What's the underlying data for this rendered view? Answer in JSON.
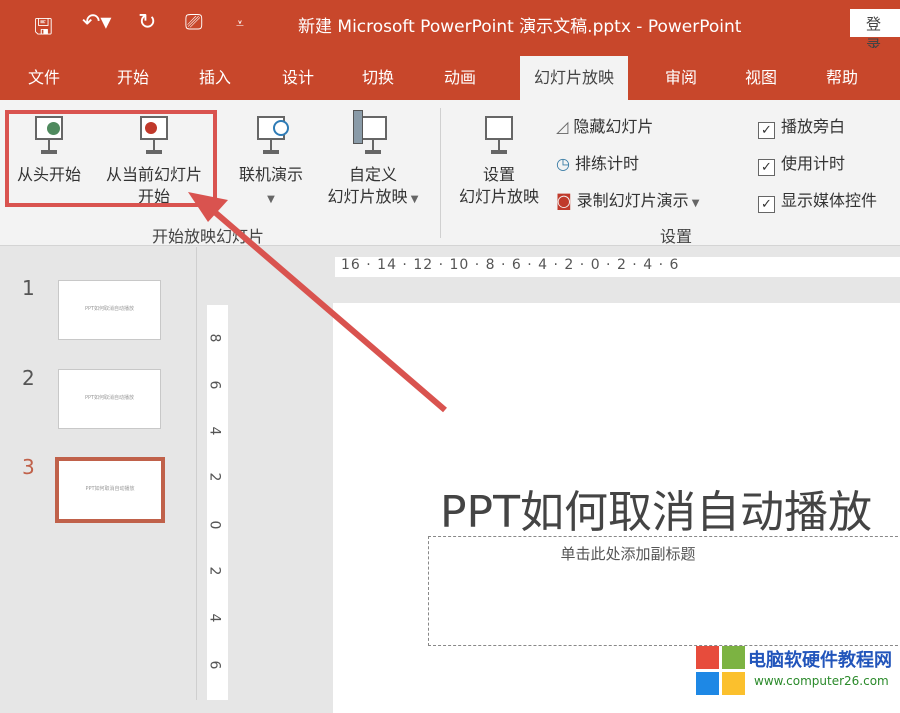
{
  "titlebar": {
    "title": "新建 Microsoft PowerPoint 演示文稿.pptx  -  PowerPoint",
    "login": "登录"
  },
  "tabs": [
    "文件",
    "开始",
    "插入",
    "设计",
    "切换",
    "动画",
    "幻灯片放映",
    "审阅",
    "视图",
    "帮助"
  ],
  "ribbon": {
    "from_beginning": "从头开始",
    "from_current_l1": "从当前幻灯片",
    "from_current_l2": "开始",
    "online": "联机演示",
    "custom_l1": "自定义",
    "custom_l2": "幻灯片放映",
    "setup_l1": "设置",
    "setup_l2": "幻灯片放映",
    "hide": "隐藏幻灯片",
    "rehearse": "排练计时",
    "record": "录制幻灯片演示",
    "narration": "播放旁白",
    "timings": "使用计时",
    "media": "显示媒体控件",
    "group_start": "开始放映幻灯片",
    "group_setup": "设置",
    "check": "✓"
  },
  "slides": [
    {
      "num": "1",
      "text": "PPT如何取消自动播放"
    },
    {
      "num": "2",
      "text": "PPT如何取消自动播放"
    },
    {
      "num": "3",
      "text": "PPT如何取消自动播放"
    }
  ],
  "ruler_h": "16 · 14 · 12 · 10 · 8 · 6 · 4 · 2 · 0 · 2 · 4 · 6",
  "ruler_v": [
    "8",
    "6",
    "4",
    "2",
    "0",
    "2",
    "4",
    "6"
  ],
  "slide": {
    "title": "PPT如何取消自动播放",
    "subtitle": "单击此处添加副标题"
  },
  "watermark": {
    "name": "电脑软硬件教程网",
    "url": "www.computer26.com"
  },
  "colors": {
    "accent": "#c8472b",
    "highlight": "#d9534f"
  }
}
